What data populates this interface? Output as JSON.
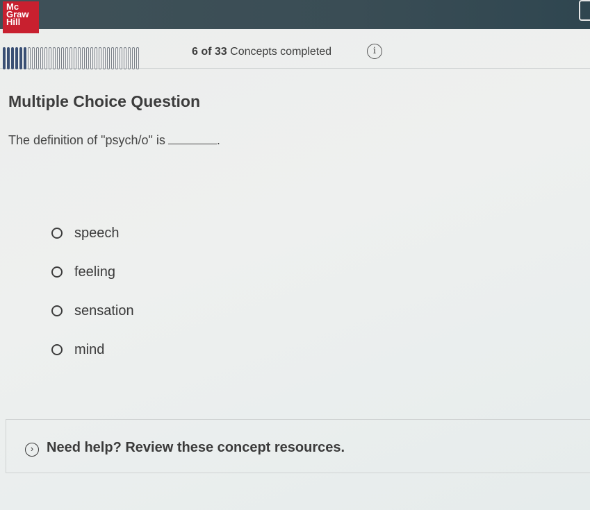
{
  "brand": {
    "logo_line1": "Mc",
    "logo_line2": "Graw",
    "logo_line3": "Hill"
  },
  "progress": {
    "completed": 6,
    "total": 33,
    "text_count": "6 of 33",
    "text_suffix": " Concepts completed",
    "info_icon": "info-icon"
  },
  "question": {
    "type": "Multiple Choice Question",
    "prompt": "The definition of \"psych/o\" is",
    "prompt_end": ".",
    "options": [
      {
        "label": "speech"
      },
      {
        "label": "feeling"
      },
      {
        "label": "sensation"
      },
      {
        "label": "mind"
      }
    ]
  },
  "help": {
    "label": "Need help? Review these concept resources.",
    "icon": "chevron-right-circle-icon"
  },
  "colors": {
    "brand_red": "#c8202f",
    "header": "#3f5158",
    "progress_done": "#3a4f74"
  }
}
